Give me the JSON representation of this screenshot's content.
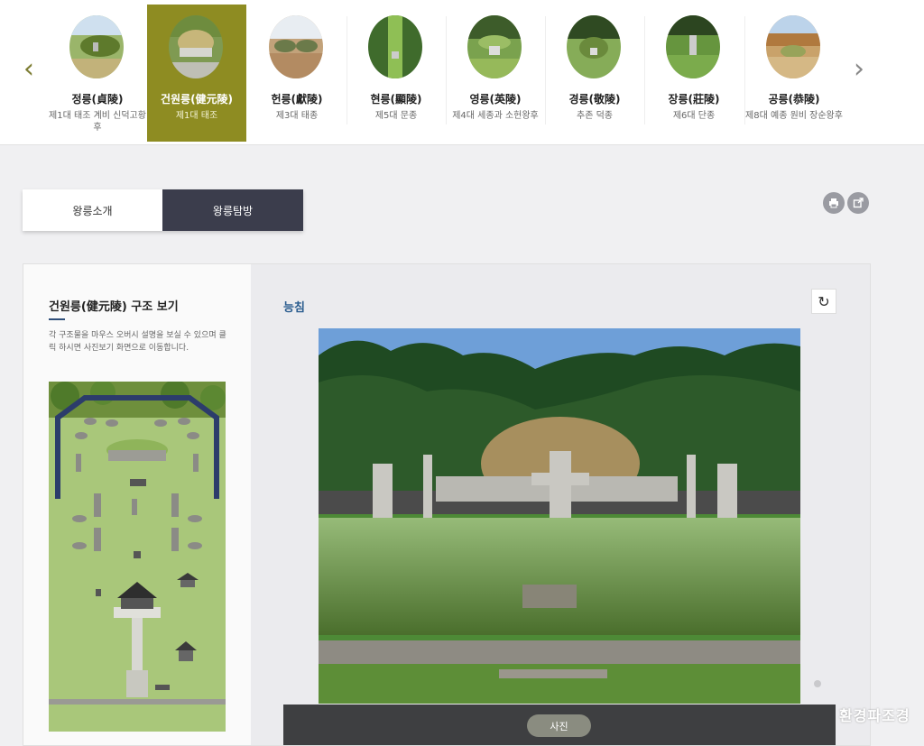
{
  "carousel": {
    "prev_icon": "chevron-left-icon",
    "next_icon": "chevron-right-icon",
    "items": [
      {
        "name": "정릉(貞陵)",
        "sub": "제1대 태조 계비 신덕고황후",
        "active": false
      },
      {
        "name": "건원릉(健元陵)",
        "sub": "제1대 태조",
        "active": true
      },
      {
        "name": "헌릉(獻陵)",
        "sub": "제3대 태종",
        "active": false
      },
      {
        "name": "현릉(顯陵)",
        "sub": "제5대 문종",
        "active": false
      },
      {
        "name": "영릉(英陵)",
        "sub": "제4대 세종과 소헌왕후",
        "active": false
      },
      {
        "name": "경릉(敬陵)",
        "sub": "추존 덕종",
        "active": false
      },
      {
        "name": "장릉(莊陵)",
        "sub": "제6대 단종",
        "active": false
      },
      {
        "name": "공릉(恭陵)",
        "sub": "제8대 예종 원비 장순왕후",
        "active": false
      }
    ]
  },
  "tabs": {
    "intro": "왕릉소개",
    "explore": "왕릉탐방",
    "active": "explore"
  },
  "actions": {
    "print_icon": "print-icon",
    "share_icon": "share-icon"
  },
  "structure": {
    "title": "건원릉(健元陵) 구조 보기",
    "description": "각 구조물을 마우스 오버시 설명을 보실 수 있으며 클릭 하시면 사진보기 화면으로 이동합니다."
  },
  "viewer": {
    "section_title": "능침",
    "refresh_icon": "refresh-icon",
    "photo_button": "사진"
  },
  "watermark": "환경파조경",
  "colors": {
    "accent": "#8e8c22",
    "tab_dark": "#3b3d4c",
    "title_blue": "#2b5d8f"
  }
}
